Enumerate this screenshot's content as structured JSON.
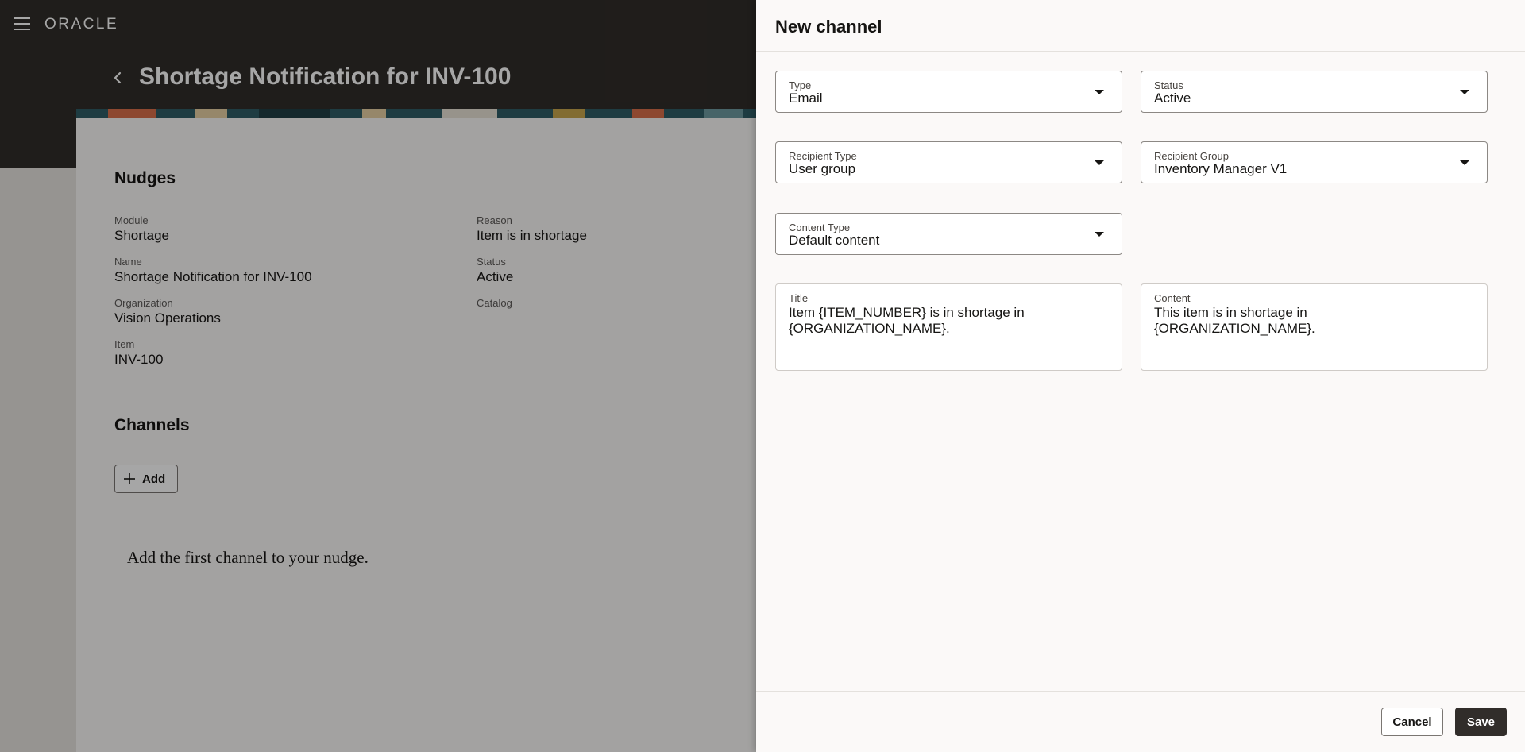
{
  "header": {
    "logo": "ORACLE",
    "page_title": "Shortage Notification for INV-100"
  },
  "nudges": {
    "heading": "Nudges",
    "fields": [
      {
        "label": "Module",
        "value": "Shortage"
      },
      {
        "label": "Name",
        "value": "Shortage Notification for INV-100"
      },
      {
        "label": "Organization",
        "value": "Vision Operations"
      },
      {
        "label": "Item",
        "value": "INV-100"
      },
      {
        "label": "Reason",
        "value": "Item is in shortage"
      },
      {
        "label": "Status",
        "value": "Active"
      },
      {
        "label": "Catalog",
        "value": ""
      }
    ]
  },
  "channels": {
    "heading": "Channels",
    "add_label": "Add",
    "empty_message": "Add the first channel to your nudge."
  },
  "drawer": {
    "title": "New channel",
    "type": {
      "label": "Type",
      "value": "Email"
    },
    "status": {
      "label": "Status",
      "value": "Active"
    },
    "recipient_type": {
      "label": "Recipient Type",
      "value": "User group"
    },
    "recipient_group": {
      "label": "Recipient Group",
      "value": "Inventory Manager V1"
    },
    "content_type": {
      "label": "Content Type",
      "value": "Default content"
    },
    "title_field": {
      "label": "Title",
      "value": "Item {ITEM_NUMBER} is in shortage in {ORGANIZATION_NAME}."
    },
    "content_field": {
      "label": "Content",
      "value": "This item is in shortage in {ORGANIZATION_NAME}."
    },
    "cancel_label": "Cancel",
    "save_label": "Save"
  },
  "colors": {
    "header_bg": "#312d2a",
    "scrim": "rgba(0,0,0,0.35)",
    "primary_button": "#312d2a"
  }
}
